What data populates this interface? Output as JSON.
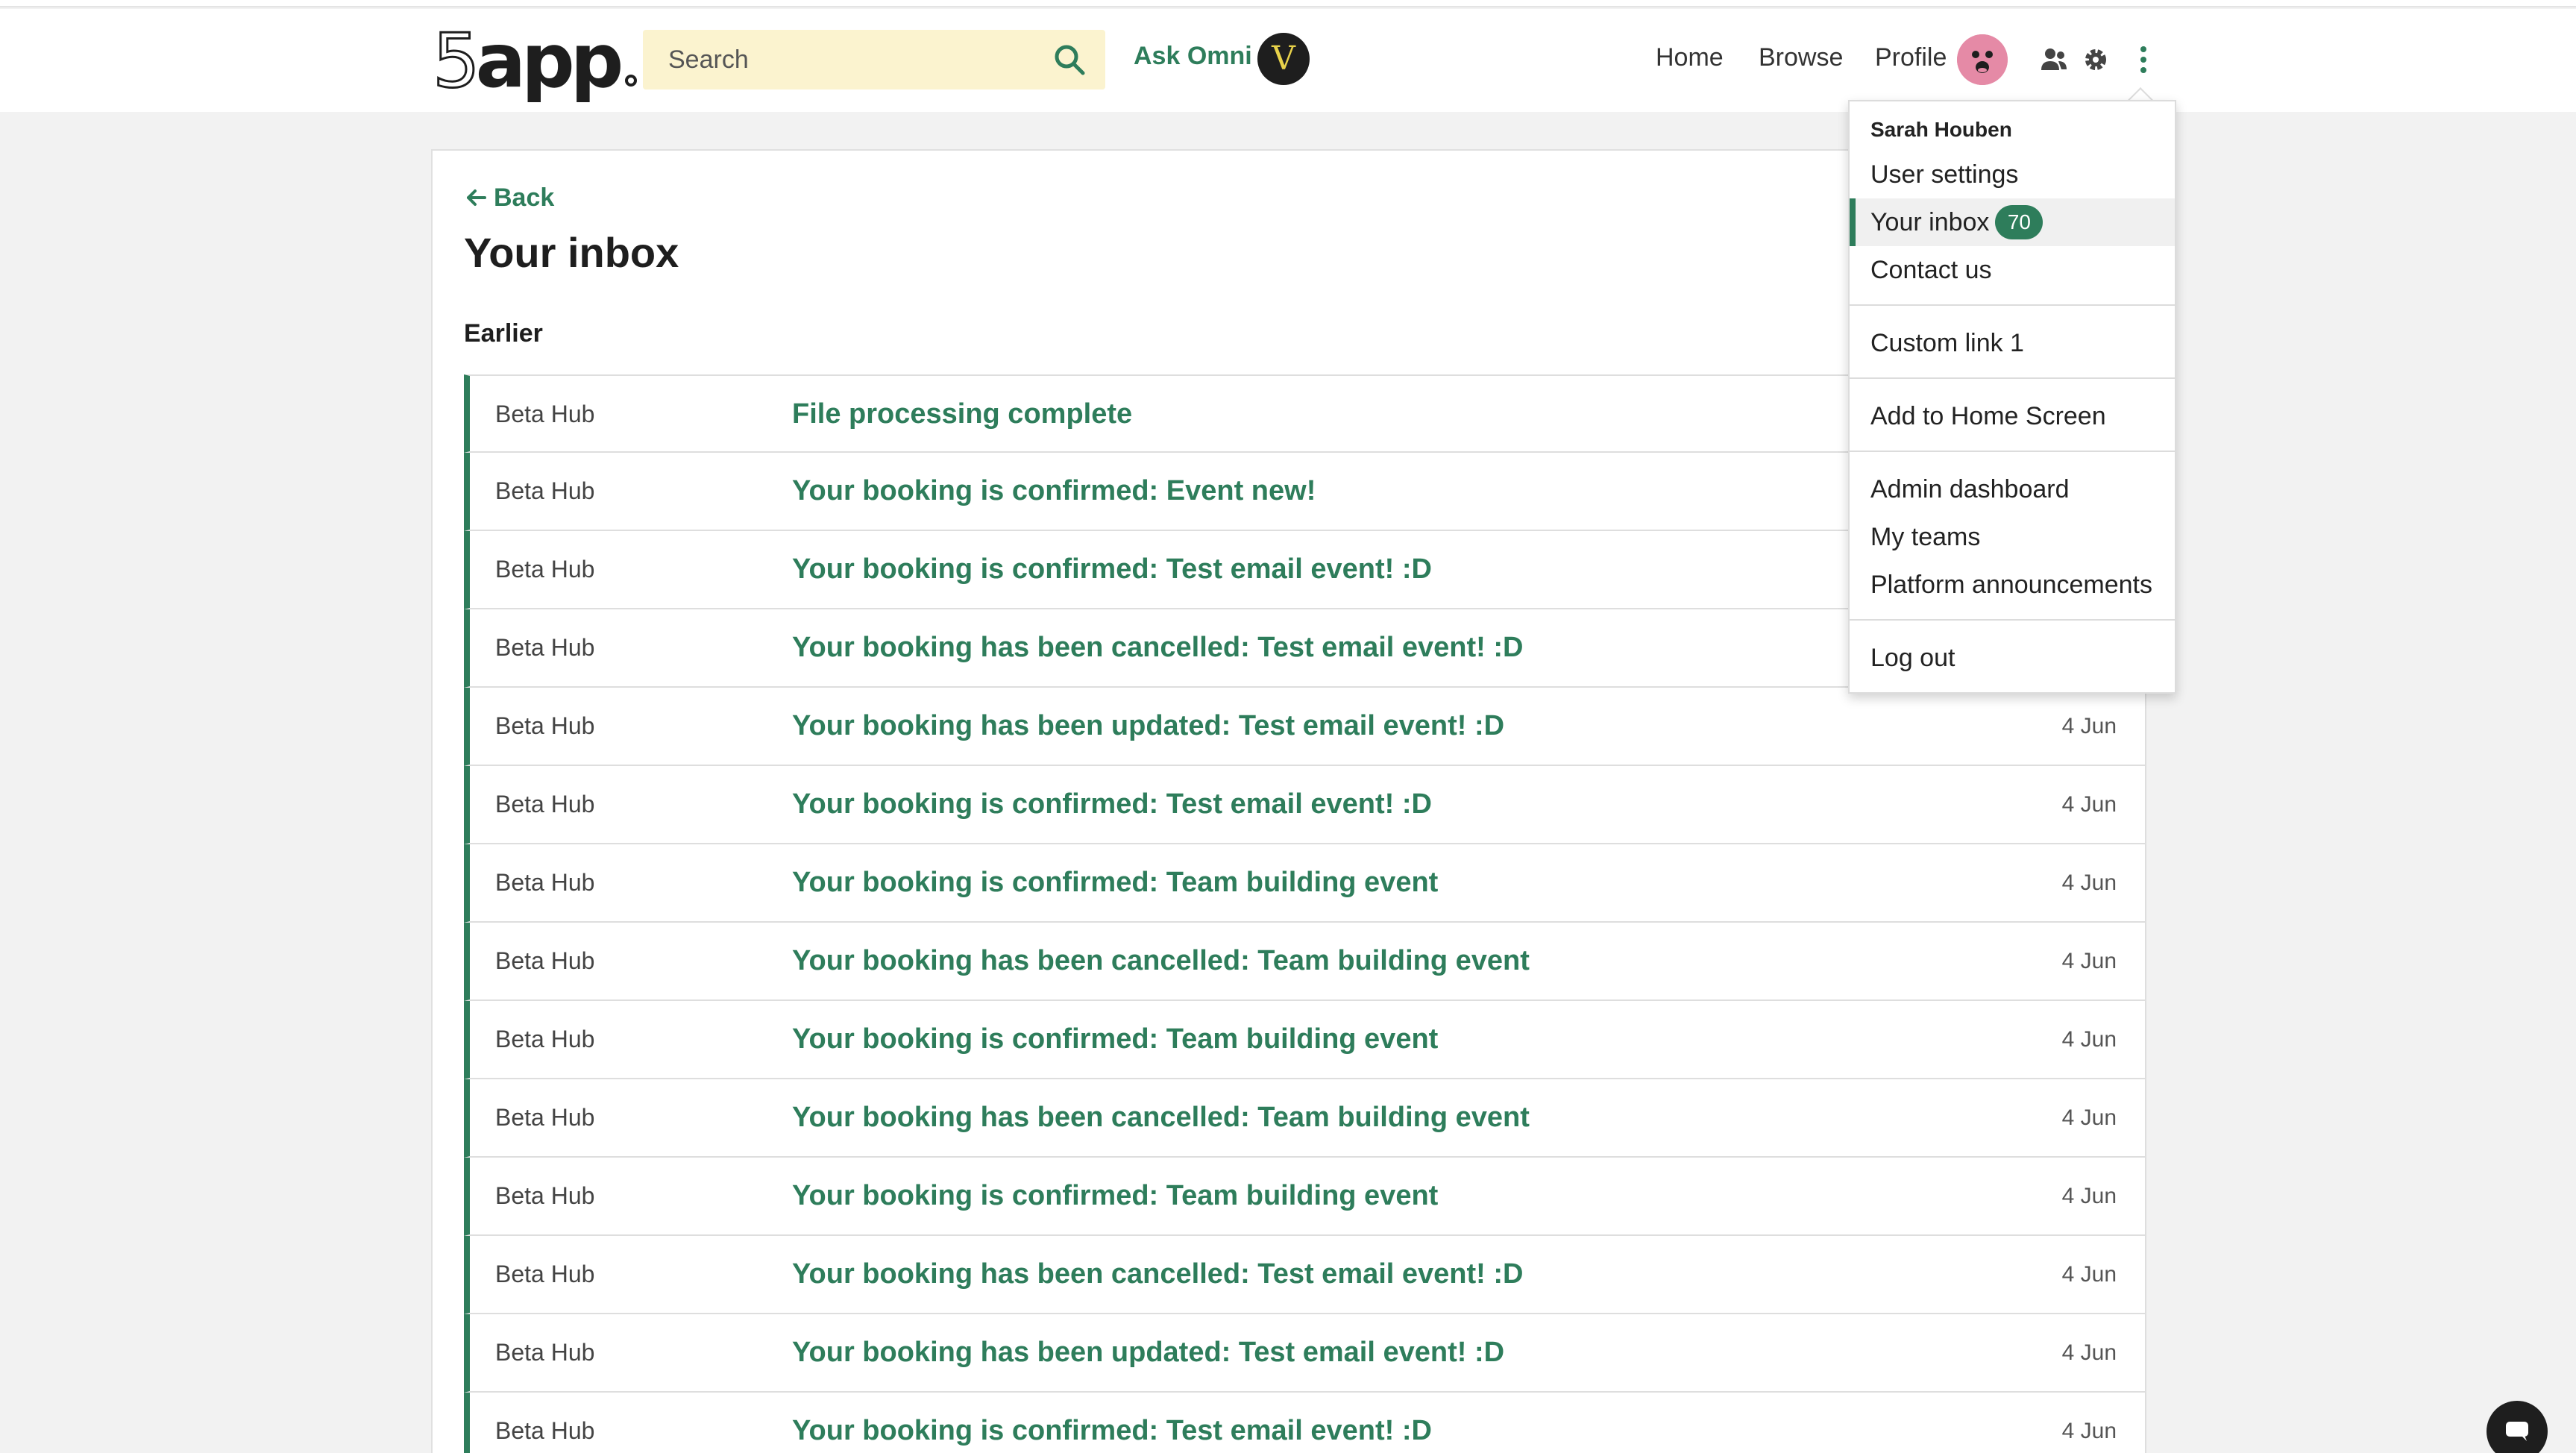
{
  "header": {
    "logo_text": "5app",
    "search": {
      "placeholder": "Search"
    },
    "ask_omni_label": "Ask Omni",
    "omni_badge": "V",
    "nav": {
      "home": "Home",
      "browse": "Browse",
      "profile": "Profile"
    }
  },
  "page": {
    "back_label": "Back",
    "title": "Your inbox",
    "section": "Earlier"
  },
  "messages": [
    {
      "source": "Beta Hub",
      "subject": "File processing complete",
      "date": ""
    },
    {
      "source": "Beta Hub",
      "subject": "Your booking is confirmed: Event new!",
      "date": ""
    },
    {
      "source": "Beta Hub",
      "subject": "Your booking is confirmed: Test email event! :D",
      "date": ""
    },
    {
      "source": "Beta Hub",
      "subject": "Your booking has been cancelled: Test email event! :D",
      "date": ""
    },
    {
      "source": "Beta Hub",
      "subject": "Your booking has been updated: Test email event! :D",
      "date": "4 Jun"
    },
    {
      "source": "Beta Hub",
      "subject": "Your booking is confirmed: Test email event! :D",
      "date": "4 Jun"
    },
    {
      "source": "Beta Hub",
      "subject": "Your booking is confirmed: Team building event",
      "date": "4 Jun"
    },
    {
      "source": "Beta Hub",
      "subject": "Your booking has been cancelled: Team building event",
      "date": "4 Jun"
    },
    {
      "source": "Beta Hub",
      "subject": "Your booking is confirmed: Team building event",
      "date": "4 Jun"
    },
    {
      "source": "Beta Hub",
      "subject": "Your booking has been cancelled: Team building event",
      "date": "4 Jun"
    },
    {
      "source": "Beta Hub",
      "subject": "Your booking is confirmed: Team building event",
      "date": "4 Jun"
    },
    {
      "source": "Beta Hub",
      "subject": "Your booking has been cancelled: Test email event! :D",
      "date": "4 Jun"
    },
    {
      "source": "Beta Hub",
      "subject": "Your booking has been updated: Test email event! :D",
      "date": "4 Jun"
    },
    {
      "source": "Beta Hub",
      "subject": "Your booking is confirmed: Test email event! :D",
      "date": "4 Jun"
    }
  ],
  "menu": {
    "user_name": "Sarah Houben",
    "user_settings": "User settings",
    "inbox": "Your inbox",
    "inbox_count": "70",
    "contact": "Contact us",
    "custom_link": "Custom link 1",
    "add_home": "Add to Home Screen",
    "admin": "Admin dashboard",
    "teams": "My teams",
    "announcements": "Platform announcements",
    "logout": "Log out"
  },
  "colors": {
    "accent": "#2e7d5b",
    "search_bg": "#fbf3cf",
    "page_bg": "#f2f2f2"
  }
}
